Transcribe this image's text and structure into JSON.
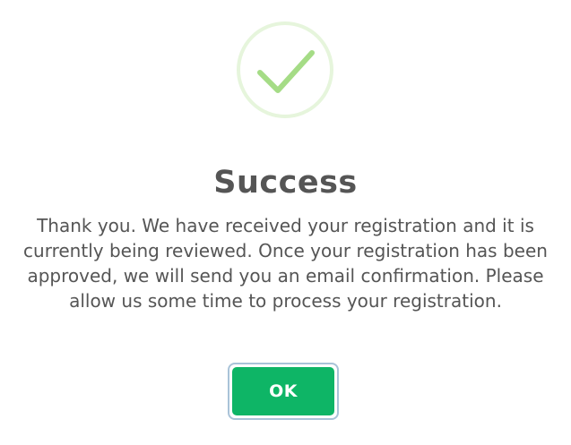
{
  "dialog": {
    "icon": "checkmark-icon",
    "title": "Success",
    "message": "Thank you. We have received your registration and it is currently being reviewed. Once your registration has been approved, we will send you an email confirmation. Please allow us some time to process your registration.",
    "ok_label": "OK"
  },
  "colors": {
    "icon_ring": "#e6f5dc",
    "icon_check": "#a5dc86",
    "text": "#555555",
    "button_bg": "#0eb566",
    "button_text": "#ffffff",
    "button_focus_ring": "#a9c3d8"
  }
}
